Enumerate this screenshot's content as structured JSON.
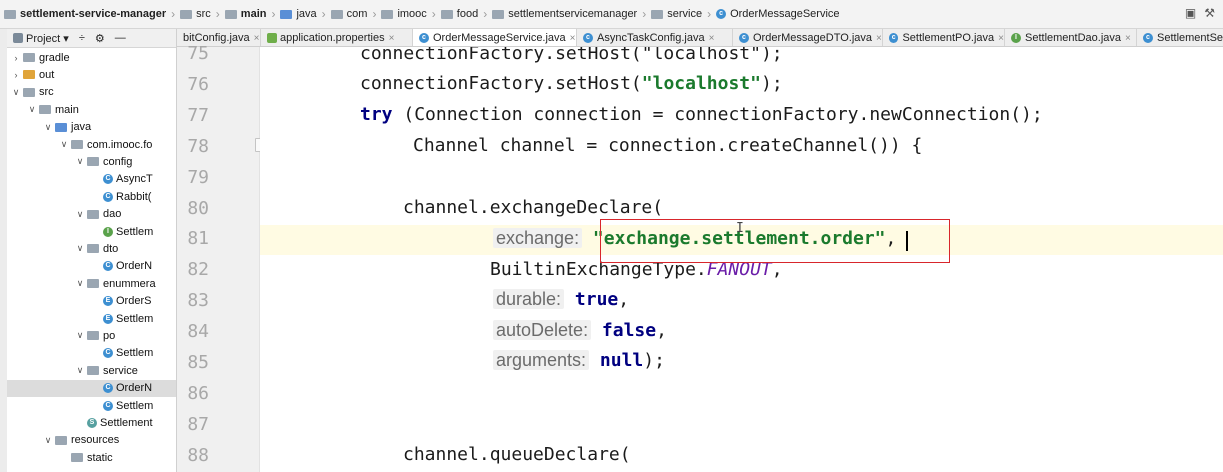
{
  "breadcrumb": [
    {
      "label": "settlement-service-manager",
      "icon": "module-icon",
      "bold": true
    },
    {
      "label": "src",
      "icon": "folder-icon"
    },
    {
      "label": "main",
      "icon": "folder-icon",
      "bold": true
    },
    {
      "label": "java",
      "icon": "folder-blue-icon"
    },
    {
      "label": "com",
      "icon": "package-icon"
    },
    {
      "label": "imooc",
      "icon": "package-icon"
    },
    {
      "label": "food",
      "icon": "package-icon"
    },
    {
      "label": "settlementservicemanager",
      "icon": "package-icon"
    },
    {
      "label": "service",
      "icon": "package-icon"
    },
    {
      "label": "OrderMessageService",
      "icon": "class-icon"
    }
  ],
  "project_panel": {
    "title": "Project",
    "tree": [
      {
        "label": "gradle",
        "indent": 1,
        "arrow": "right",
        "icon": "folder"
      },
      {
        "label": "out",
        "indent": 1,
        "arrow": "right",
        "icon": "folder-orange"
      },
      {
        "label": "src",
        "indent": 1,
        "arrow": "down",
        "icon": "folder"
      },
      {
        "label": "main",
        "indent": 2,
        "arrow": "down",
        "icon": "folder"
      },
      {
        "label": "java",
        "indent": 3,
        "arrow": "down",
        "icon": "folder-blue"
      },
      {
        "label": "com.imooc.fo",
        "indent": 4,
        "arrow": "down",
        "icon": "folder"
      },
      {
        "label": "config",
        "indent": 5,
        "arrow": "down",
        "icon": "folder"
      },
      {
        "label": "AsyncT",
        "indent": 6,
        "arrow": "",
        "icon": "class-c"
      },
      {
        "label": "Rabbit(",
        "indent": 6,
        "arrow": "",
        "icon": "class-c"
      },
      {
        "label": "dao",
        "indent": 5,
        "arrow": "down",
        "icon": "folder"
      },
      {
        "label": "Settlem",
        "indent": 6,
        "arrow": "",
        "icon": "class-i"
      },
      {
        "label": "dto",
        "indent": 5,
        "arrow": "down",
        "icon": "folder"
      },
      {
        "label": "OrderN",
        "indent": 6,
        "arrow": "",
        "icon": "class-c"
      },
      {
        "label": "enummera",
        "indent": 5,
        "arrow": "down",
        "icon": "folder"
      },
      {
        "label": "OrderS",
        "indent": 6,
        "arrow": "",
        "icon": "class-e"
      },
      {
        "label": "Settlem",
        "indent": 6,
        "arrow": "",
        "icon": "class-e"
      },
      {
        "label": "po",
        "indent": 5,
        "arrow": "down",
        "icon": "folder"
      },
      {
        "label": "Settlem",
        "indent": 6,
        "arrow": "",
        "icon": "class-c"
      },
      {
        "label": "service",
        "indent": 5,
        "arrow": "down",
        "icon": "folder"
      },
      {
        "label": "OrderN",
        "indent": 6,
        "arrow": "",
        "icon": "class-c",
        "selected": true
      },
      {
        "label": "Settlem",
        "indent": 6,
        "arrow": "",
        "icon": "class-c"
      },
      {
        "label": "Settlement",
        "indent": 5,
        "arrow": "",
        "icon": "class-s"
      },
      {
        "label": "resources",
        "indent": 3,
        "arrow": "down",
        "icon": "folder"
      },
      {
        "label": "static",
        "indent": 4,
        "arrow": "",
        "icon": "folder"
      }
    ]
  },
  "tabs": [
    {
      "label": "bitConfig.java",
      "icon": "class-icon",
      "close": "×"
    },
    {
      "label": "application.properties",
      "icon": "properties-icon",
      "close": "×"
    },
    {
      "label": "OrderMessageService.java",
      "icon": "class-icon",
      "close": "×",
      "active": true
    },
    {
      "label": "AsyncTaskConfig.java",
      "icon": "class-icon",
      "close": "×"
    },
    {
      "label": "OrderMessageDTO.java",
      "icon": "class-icon",
      "close": "×"
    },
    {
      "label": "SettlementPO.java",
      "icon": "class-icon",
      "close": "×"
    },
    {
      "label": "SettlementDao.java",
      "icon": "interface-icon",
      "close": "×"
    },
    {
      "label": "SettlementSe",
      "icon": "class-icon",
      "close": ""
    }
  ],
  "line_numbers": [
    "75",
    "76",
    "77",
    "78",
    "79",
    "80",
    "81",
    "82",
    "83",
    "84",
    "85",
    "86",
    "87",
    "88"
  ],
  "code": {
    "l75": "connectionFactory.setHost(\"localhost\");",
    "l76_a": "connectionFactory.setHost(",
    "l76_s": "\"localhost\"",
    "l76_b": ");",
    "l77_kw": "try",
    "l77_rest": " (Connection connection = connectionFactory.newConnection();",
    "l78": "Channel channel = connection.createChannel()) {",
    "l80": "channel.exchangeDeclare(",
    "l81_hint": "exchange:",
    "l81_s": "\"exchange.settlement.order\"",
    "l81_b": ",",
    "l82_a": "BuiltinExchangeType.",
    "l82_i": "FANOUT",
    "l82_b": ",",
    "l83_hint": "durable:",
    "l83_kw": "true",
    "l83_b": ",",
    "l84_hint": "autoDelete:",
    "l84_kw": "false",
    "l84_b": ",",
    "l85_hint": "arguments:",
    "l85_kw": "null",
    "l85_b": ");",
    "l88": "channel.queueDeclare("
  },
  "colors": {
    "keyword": "#000080",
    "string": "#1b7a2d",
    "enum_constant": "#6a1da8",
    "highlight_box": "#d8262c",
    "current_line": "#fffbe3"
  }
}
